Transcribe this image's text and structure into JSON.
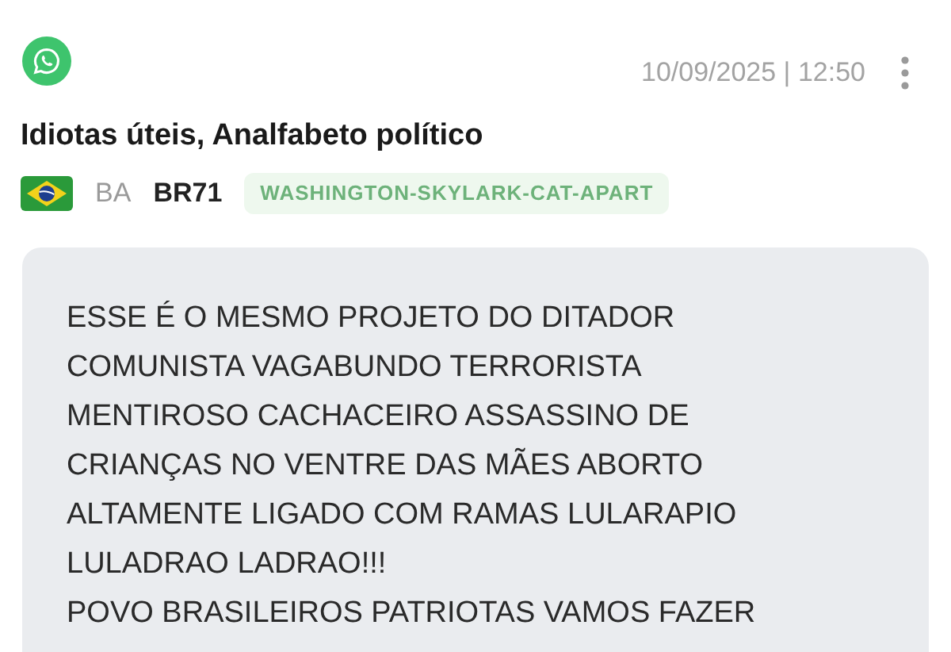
{
  "header": {
    "timestamp": "10/09/2025 | 12:50"
  },
  "title": "Idiotas úteis, Analfabeto político",
  "meta": {
    "region": "BA",
    "code": "BR71",
    "tag": "WASHINGTON-SKYLARK-CAT-APART"
  },
  "message": {
    "lines": [
      "ESSE É O MESMO PROJETO DO DITADOR",
      "COMUNISTA VAGABUNDO TERRORISTA",
      "MENTIROSO CACHACEIRO ASSASSINO DE",
      "CRIANÇAS NO VENTRE DAS MÃES ABORTO",
      "ALTAMENTE LIGADO COM RAMAS LULARAPIO",
      "LULADRAO LADRAO!!!",
      "POVO BRASILEIROS PATRIOTAS VAMOS FAZER"
    ]
  }
}
